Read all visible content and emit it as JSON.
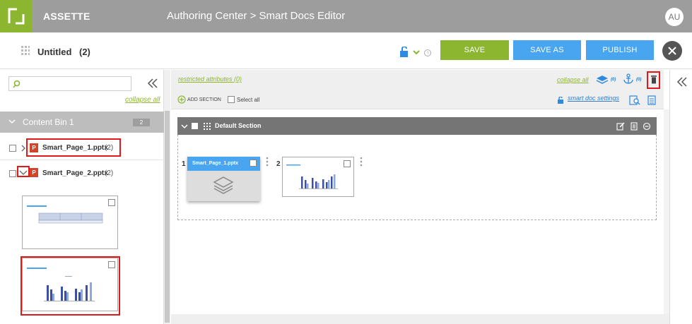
{
  "header": {
    "brand": "ASSETTE",
    "breadcrumb": "Authoring Center > Smart Docs Editor",
    "avatar_initials": "AU"
  },
  "titlebar": {
    "title": "Untitled",
    "count": "(2)",
    "buttons": {
      "save": "SAVE",
      "save_as": "SAVE AS",
      "publish": "PUBLISH"
    }
  },
  "sidebar": {
    "collapse_all": "collapse all",
    "bin": {
      "title": "Content Bin 1",
      "count": "2"
    },
    "files": [
      {
        "name": "Smart_Page_1.pptx",
        "count": "(2)"
      },
      {
        "name": "Smart_Page_2.pptx",
        "count": "(2)"
      }
    ]
  },
  "toolbar": {
    "restricted": "restricted attributes (0)",
    "collapse_all": "collapse all",
    "layers_count": "(0)",
    "anchor_count": "(0)",
    "add_section": "ADD SECTION",
    "select_all": "Select all",
    "smart_settings": "smart doc settings"
  },
  "section": {
    "title": "Default Section",
    "pages": [
      {
        "index": "1",
        "label": "Smart_Page_1.pptx"
      },
      {
        "index": "2",
        "label": ""
      }
    ]
  },
  "colors": {
    "brand_green": "#8cb630",
    "blue": "#4aa5f0",
    "highlight_red": "#e0191b"
  }
}
